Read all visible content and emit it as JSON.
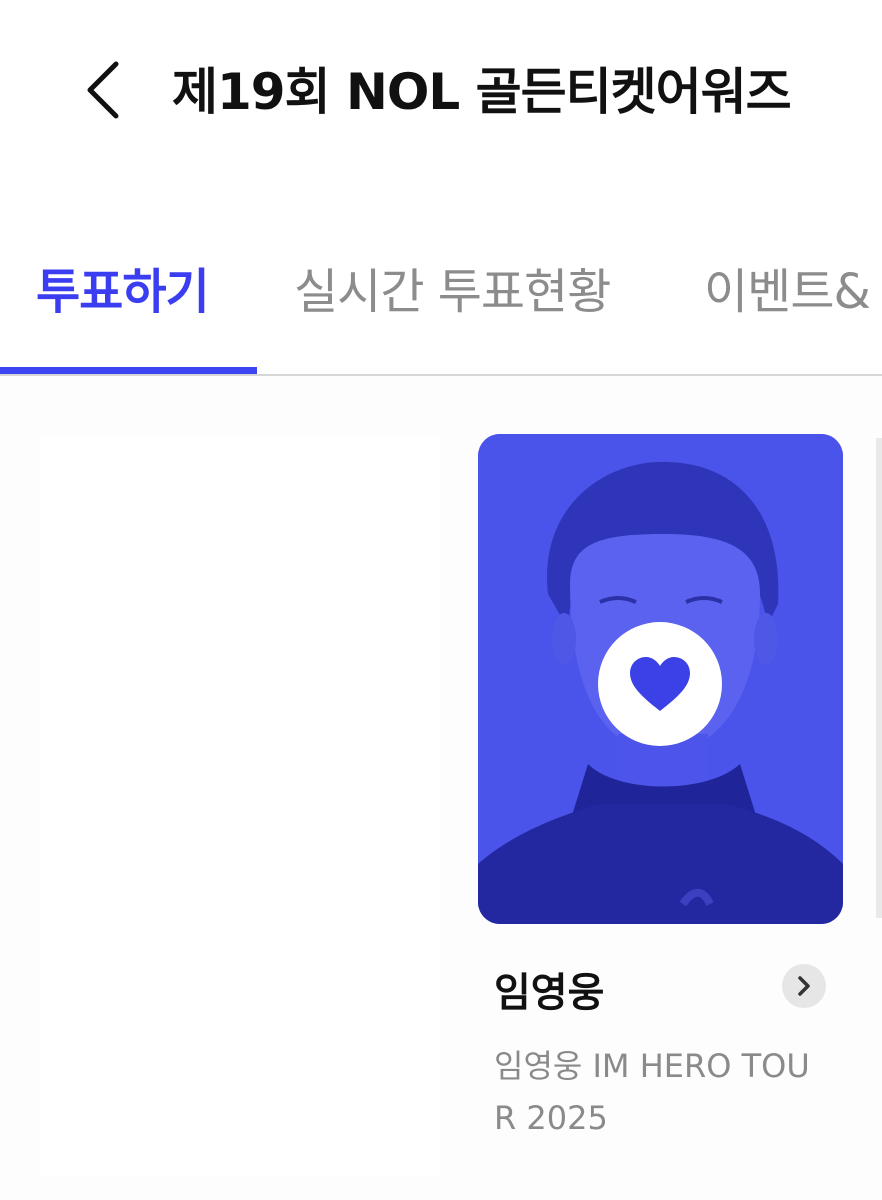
{
  "header": {
    "title": "제19회 NOL 골든티켓어워즈"
  },
  "tabs": [
    {
      "label": "투표하기",
      "active": true
    },
    {
      "label": "실시간 투표현황",
      "active": false
    },
    {
      "label": "이벤트&",
      "active": false
    }
  ],
  "artist": {
    "name": "임영웅",
    "description": "임영웅 IM HERO TOUR 2025"
  },
  "colors": {
    "accent": "#3d44f2",
    "card_overlay": "#4a53ea",
    "heart": "#3b41e6"
  },
  "icons": {
    "back": "back-arrow-icon",
    "heart": "heart-icon",
    "detail": "chevron-right-icon"
  }
}
